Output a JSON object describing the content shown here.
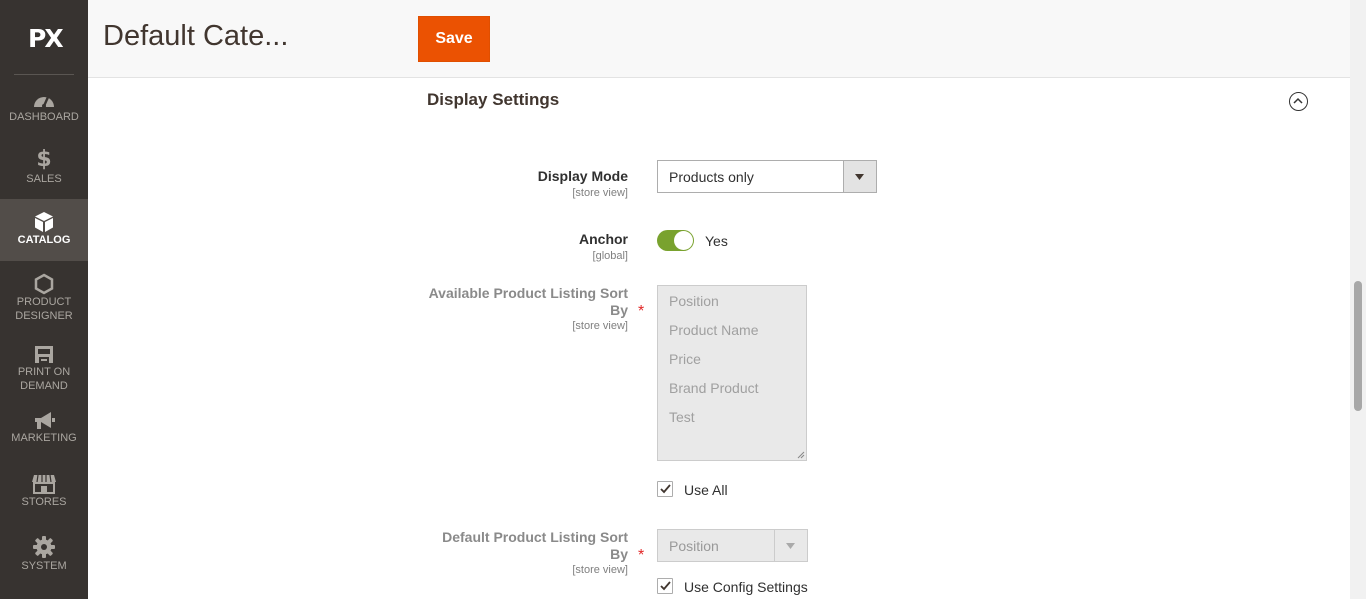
{
  "sidebar": {
    "logo": "PX",
    "items": [
      {
        "label": "DASHBOARD",
        "icon": "dashboard-gauge-icon"
      },
      {
        "label": "SALES",
        "icon": "dollar-icon"
      },
      {
        "label": "CATALOG",
        "icon": "box-icon"
      },
      {
        "label_line1": "PRODUCT",
        "label_line2": "DESIGNER",
        "icon": "hexagon-icon"
      },
      {
        "label_line1": "PRINT ON",
        "label_line2": "DEMAND",
        "icon": "print-icon"
      },
      {
        "label": "MARKETING",
        "icon": "megaphone-icon"
      },
      {
        "label": "STORES",
        "icon": "store-icon"
      },
      {
        "label": "SYSTEM",
        "icon": "gear-icon"
      }
    ],
    "active": "CATALOG"
  },
  "header": {
    "title": "Default Cate...",
    "save_label": "Save"
  },
  "section": {
    "title": "Display Settings"
  },
  "fields": {
    "display_mode": {
      "label": "Display Mode",
      "scope": "[store view]",
      "value": "Products only"
    },
    "anchor": {
      "label": "Anchor",
      "scope": "[global]",
      "value": "Yes"
    },
    "available_sort": {
      "label_line1": "Available Product Listing Sort",
      "label_line2": "By",
      "scope": "[store view]",
      "options": [
        "Position",
        "Product Name",
        "Price",
        "Brand Product",
        "Test"
      ],
      "use_all_label": "Use All"
    },
    "default_sort": {
      "label_line1": "Default Product Listing Sort",
      "label_line2": "By",
      "scope": "[store view]",
      "value": "Position",
      "use_config_label": "Use Config Settings"
    }
  },
  "colors": {
    "sidebar_bg": "#373330",
    "sidebar_active": "#524d49",
    "accent": "#eb5202",
    "toggle_on": "#79a22e",
    "required": "#e22626"
  }
}
